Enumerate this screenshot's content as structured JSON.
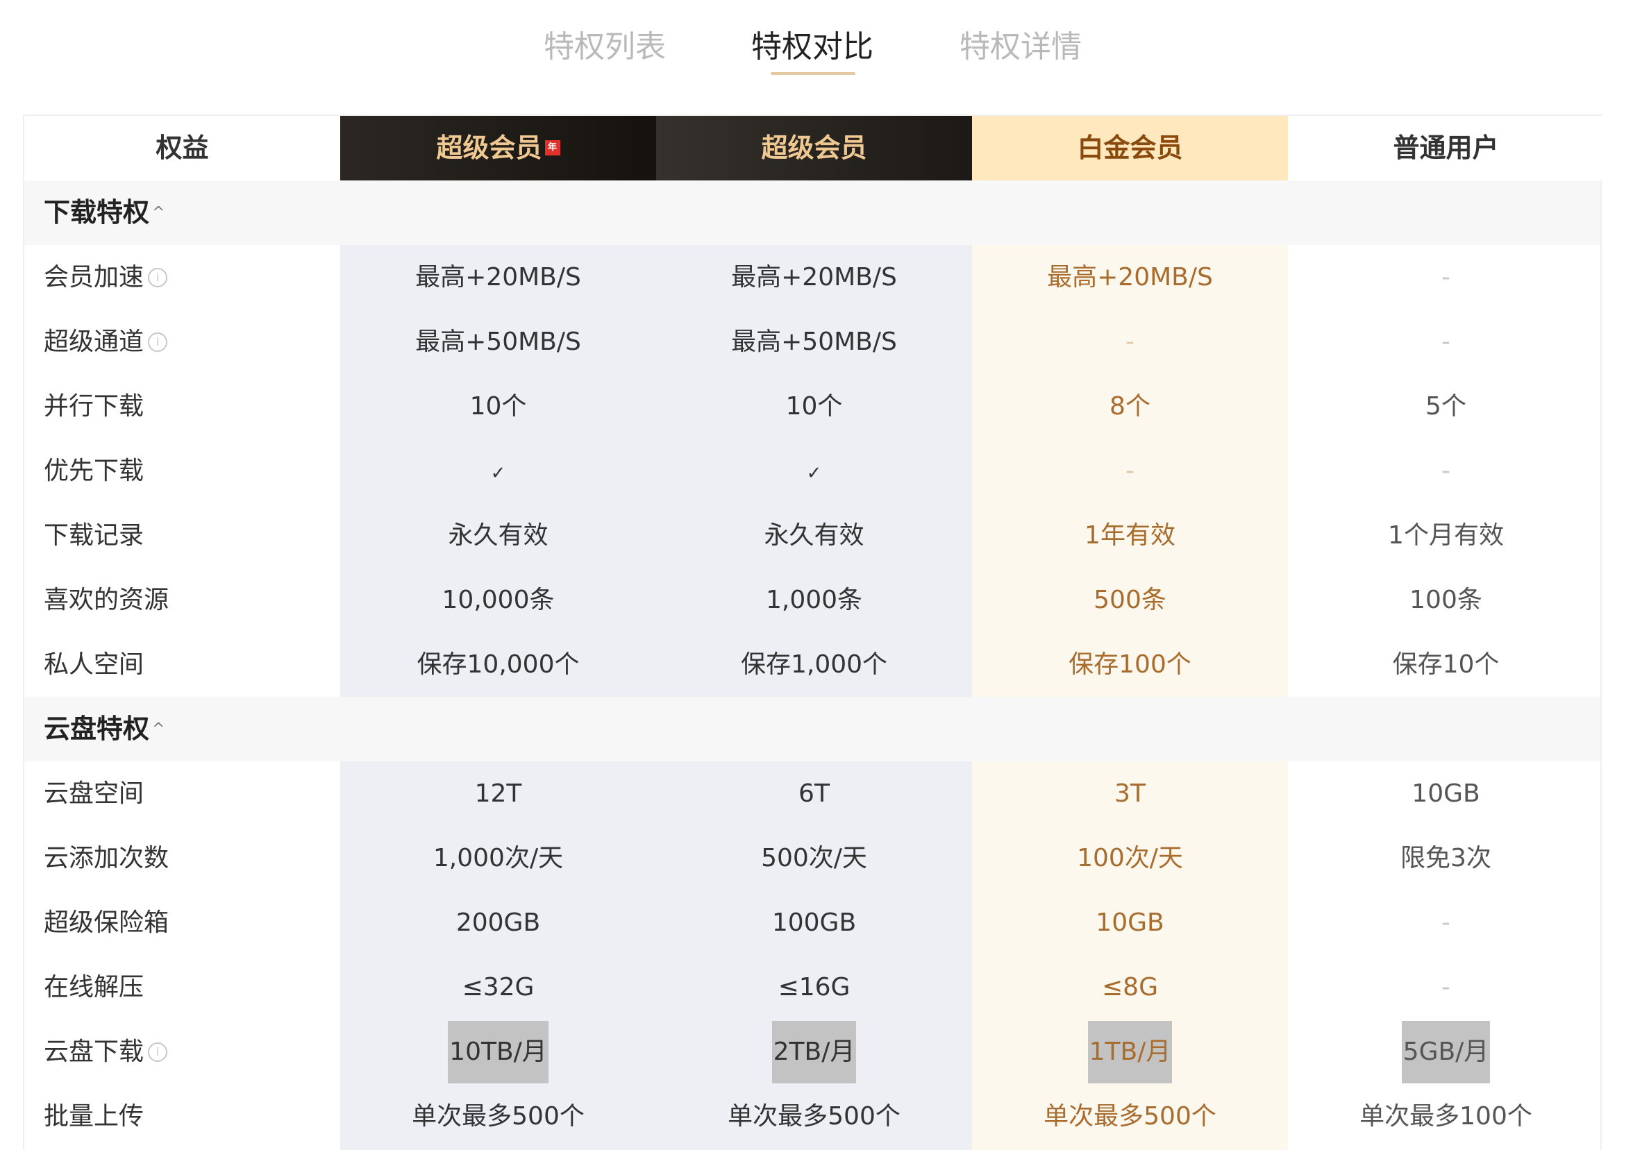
{
  "tabs": [
    {
      "label": "特权列表",
      "active": false
    },
    {
      "label": "特权对比",
      "active": true
    },
    {
      "label": "特权详情",
      "active": false
    }
  ],
  "header": {
    "col0": "权益",
    "col1": "超级会员",
    "col1_badge": "年",
    "col2": "超级会员",
    "col3": "白金会员",
    "col4": "普通用户"
  },
  "sections": [
    {
      "title": "下载特权",
      "rows": [
        {
          "name": "会员加速",
          "info": true,
          "values": [
            "最高+20MB/S",
            "最高+20MB/S",
            "最高+20MB/S",
            "-"
          ]
        },
        {
          "name": "超级通道",
          "info": true,
          "values": [
            "最高+50MB/S",
            "最高+50MB/S",
            "-",
            "-"
          ]
        },
        {
          "name": "并行下载",
          "info": false,
          "values": [
            "10个",
            "10个",
            "8个",
            "5个"
          ]
        },
        {
          "name": "优先下载",
          "info": false,
          "values": [
            "✓",
            "✓",
            "-",
            "-"
          ]
        },
        {
          "name": "下载记录",
          "info": false,
          "values": [
            "永久有效",
            "永久有效",
            "1年有效",
            "1个月有效"
          ]
        },
        {
          "name": "喜欢的资源",
          "info": false,
          "values": [
            "10,000条",
            "1,000条",
            "500条",
            "100条"
          ]
        },
        {
          "name": "私人空间",
          "info": false,
          "values": [
            "保存10,000个",
            "保存1,000个",
            "保存100个",
            "保存10个"
          ]
        }
      ]
    },
    {
      "title": "云盘特权",
      "rows": [
        {
          "name": "云盘空间",
          "info": false,
          "values": [
            "12T",
            "6T",
            "3T",
            "10GB"
          ]
        },
        {
          "name": "云添加次数",
          "info": false,
          "values": [
            "1,000次/天",
            "500次/天",
            "100次/天",
            "限免3次"
          ]
        },
        {
          "name": "超级保险箱",
          "info": false,
          "values": [
            "200GB",
            "100GB",
            "10GB",
            "-"
          ]
        },
        {
          "name": "在线解压",
          "info": false,
          "values": [
            "≤32G",
            "≤16G",
            "≤8G",
            "-"
          ]
        },
        {
          "name": "云盘下载",
          "info": true,
          "highlight": true,
          "values": [
            "10TB/月",
            "2TB/月",
            "1TB/月",
            "5GB/月"
          ]
        },
        {
          "name": "批量上传",
          "info": false,
          "values": [
            "单次最多500个",
            "单次最多500个",
            "单次最多500个",
            "单次最多100个"
          ]
        }
      ]
    }
  ],
  "icons": {
    "info": "info-icon",
    "check": "check-icon",
    "collapse": "chevron-up-icon"
  },
  "colors": {
    "super_header_text": "#f0c892",
    "platinum_header_bg": "#ffe8bd",
    "platinum_text": "#a96c2f",
    "super_col_bg": "#eeeff5",
    "platinum_col_bg": "#fdf8ee"
  }
}
